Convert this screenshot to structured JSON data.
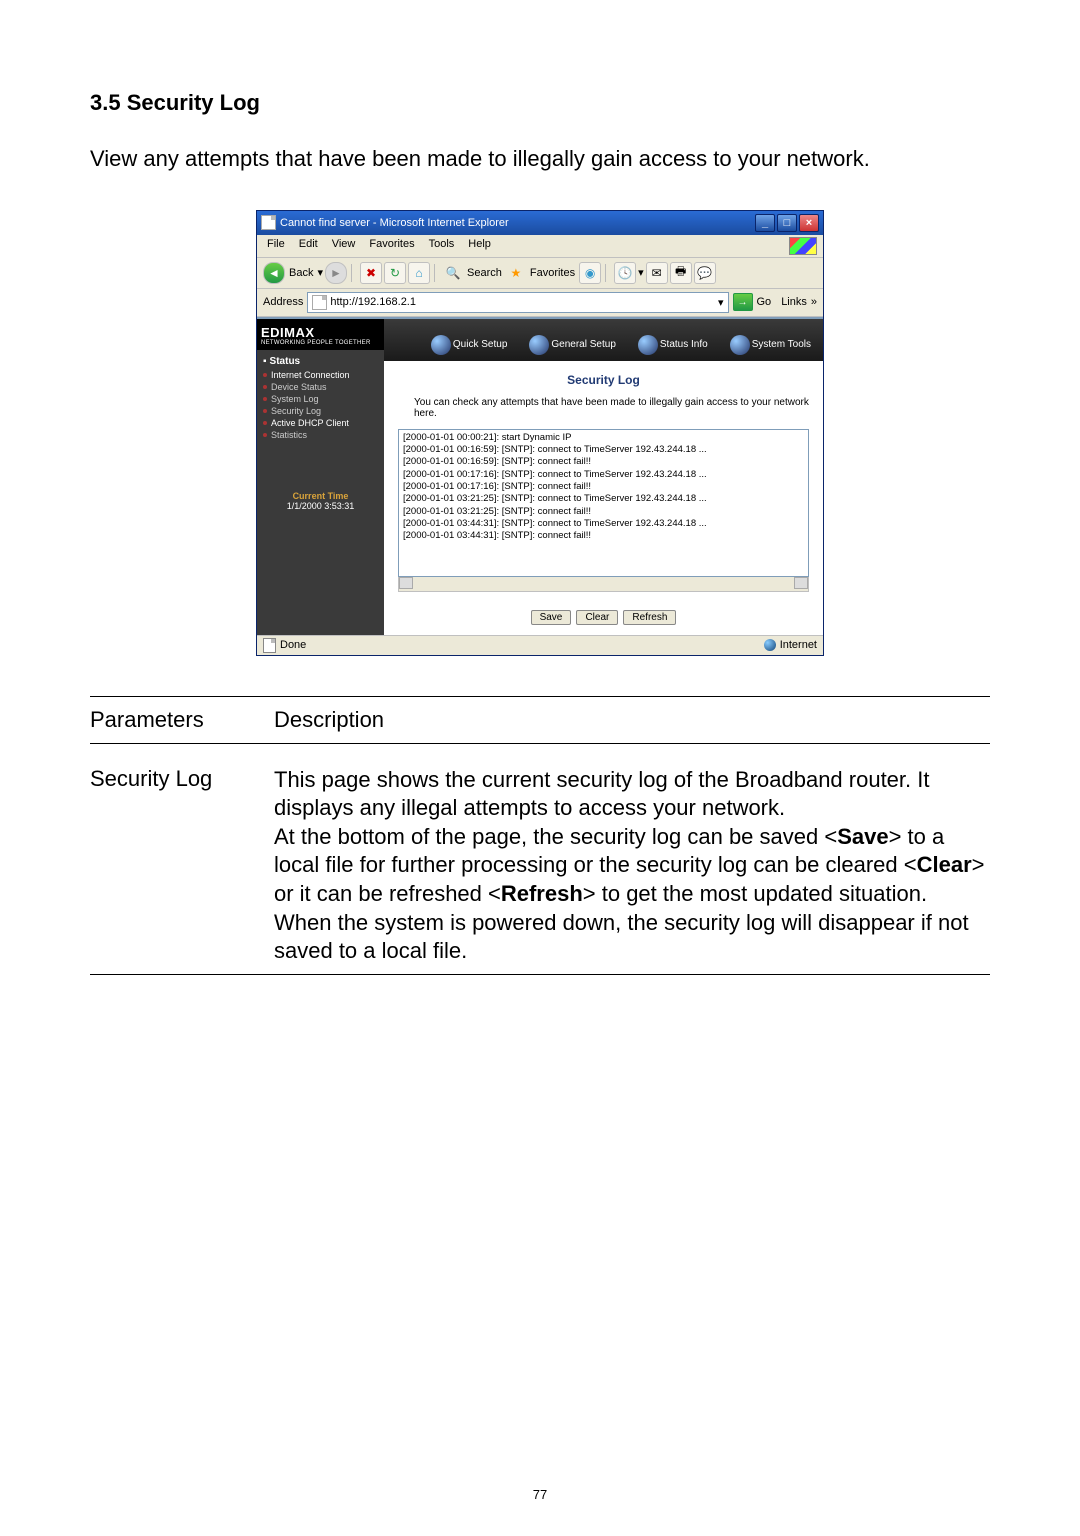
{
  "doc": {
    "heading": "3.5 Security Log",
    "intro": "View any attempts that have been made to illegally gain access to your network.",
    "page_number": "77"
  },
  "ie": {
    "title": "Cannot find server - Microsoft Internet Explorer",
    "menu": [
      "File",
      "Edit",
      "View",
      "Favorites",
      "Tools",
      "Help"
    ],
    "back": "Back",
    "search": "Search",
    "favorites": "Favorites",
    "address_label": "Address",
    "address_value": "http://192.168.2.1",
    "go": "Go",
    "links": "Links",
    "status_done": "Done",
    "status_zone": "Internet"
  },
  "brand": {
    "name": "EDIMAX",
    "tag": "NETWORKING PEOPLE TOGETHER"
  },
  "topnav": [
    "Quick Setup",
    "General Setup",
    "Status Info",
    "System Tools"
  ],
  "sidebar": {
    "section": "Status",
    "items": [
      {
        "label": "Internet Connection",
        "active": true
      },
      {
        "label": "Device Status",
        "active": false
      },
      {
        "label": "System Log",
        "active": false
      },
      {
        "label": "Security Log",
        "active": false
      },
      {
        "label": "Active DHCP Client",
        "active": true
      },
      {
        "label": "Statistics",
        "active": false
      }
    ],
    "current_time_label": "Current Time",
    "current_time_value": "1/1/2000 3:53:31"
  },
  "panel": {
    "title": "Security Log",
    "desc": "You can check any attempts that have been made to illegally gain access to your network here.",
    "log_lines": [
      "[2000-01-01 00:00:21]:  start Dynamic IP",
      "[2000-01-01 00:16:59]:  [SNTP]:  connect to TimeServer 192.43.244.18 ...",
      "[2000-01-01 00:16:59]:  [SNTP]:  connect fail!!",
      "[2000-01-01 00:17:16]:  [SNTP]:  connect to TimeServer 192.43.244.18 ...",
      "[2000-01-01 00:17:16]:  [SNTP]:  connect fail!!",
      "[2000-01-01 03:21:25]:  [SNTP]:  connect to TimeServer 192.43.244.18 ...",
      "[2000-01-01 03:21:25]:  [SNTP]:  connect fail!!",
      "[2000-01-01 03:44:31]:  [SNTP]:  connect to TimeServer 192.43.244.18 ...",
      "[2000-01-01 03:44:31]:  [SNTP]:  connect fail!!"
    ],
    "buttons": {
      "save": "Save",
      "clear": "Clear",
      "refresh": "Refresh"
    }
  },
  "table": {
    "h1": "Parameters",
    "h2": "Description",
    "row_name": "Security Log",
    "desc_p1": "This page shows the current security log of the Broadband router. It displays any illegal attempts to access your network.",
    "desc_p2a": "At the bottom of the page, the security log can be saved <",
    "desc_save": "Save",
    "desc_p2b": "> to a local file for further processing or the security log can be cleared  <",
    "desc_clear": "Clear",
    "desc_p2c": "> or it can be refreshed <",
    "desc_refresh": "Refresh",
    "desc_p2d": "> to get the most updated situation. When the system is powered down, the security log will disappear if not saved to a local file."
  }
}
